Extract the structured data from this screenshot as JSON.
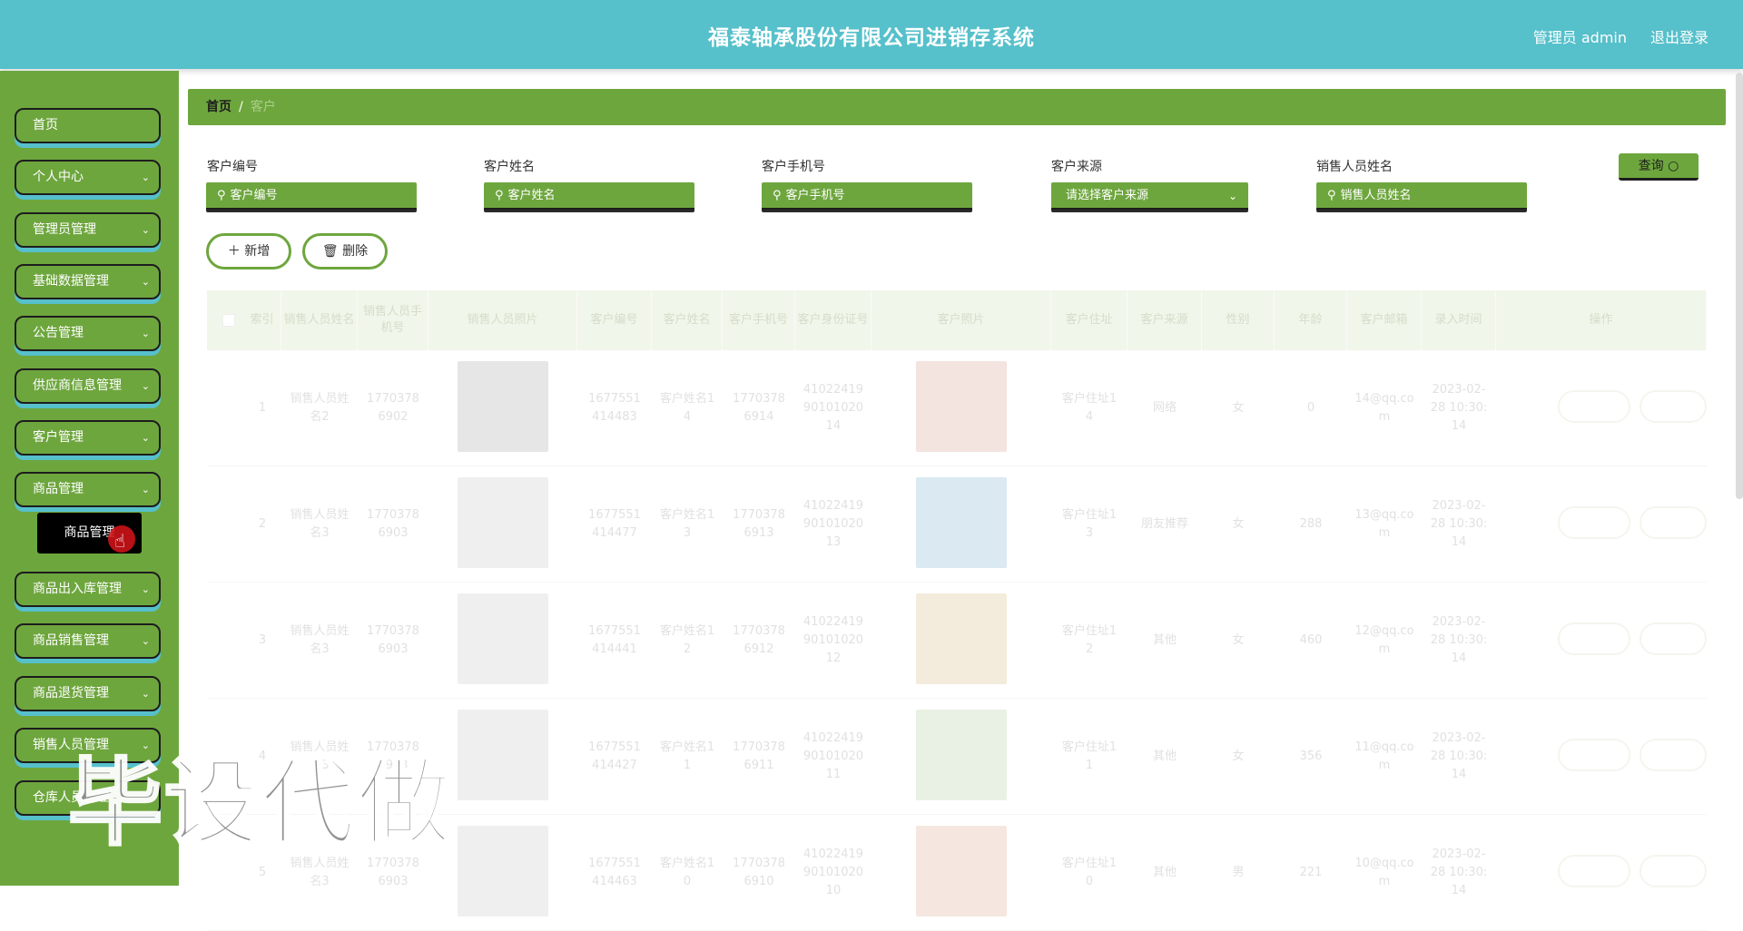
{
  "header": {
    "title": "福泰轴承股份有限公司进销存系统",
    "user": "管理员 admin",
    "logout": "退出登录"
  },
  "sidebar": {
    "items": [
      {
        "label": "首页",
        "has_children": false
      },
      {
        "label": "个人中心",
        "has_children": true
      },
      {
        "label": "管理员管理",
        "has_children": true
      },
      {
        "label": "基础数据管理",
        "has_children": true
      },
      {
        "label": "公告管理",
        "has_children": true
      },
      {
        "label": "供应商信息管理",
        "has_children": true
      },
      {
        "label": "客户管理",
        "has_children": true
      },
      {
        "label": "商品管理",
        "has_children": true
      },
      {
        "label": "商品出入库管理",
        "has_children": true
      },
      {
        "label": "商品销售管理",
        "has_children": true
      },
      {
        "label": "商品退货管理",
        "has_children": true
      },
      {
        "label": "销售人员管理",
        "has_children": true
      },
      {
        "label": "仓库人员管理",
        "has_children": true
      }
    ],
    "submenu_active": "商品管理",
    "chevron": "chevron-down-icon"
  },
  "breadcrumb": {
    "home": "首页",
    "separator": "/",
    "current": "客户"
  },
  "search": {
    "fields": [
      {
        "label": "客户编号",
        "placeholder": "客户编号"
      },
      {
        "label": "客户姓名",
        "placeholder": "客户姓名"
      },
      {
        "label": "客户手机号",
        "placeholder": "客户手机号"
      },
      {
        "label": "客户来源",
        "placeholder": "请选择客户来源"
      },
      {
        "label": "销售人员姓名",
        "placeholder": "销售人员姓名"
      }
    ],
    "query_label": "查询",
    "add_label": "新增",
    "delete_label": "删除"
  },
  "table": {
    "columns": [
      "索引",
      "销售人员姓名",
      "销售人员手机号",
      "销售人员照片",
      "客户编号",
      "客户姓名",
      "客户手机号",
      "客户身份证号",
      "客户照片",
      "客户住址",
      "客户来源",
      "性别",
      "年龄",
      "客户邮箱",
      "录入时间",
      "操作"
    ],
    "rows": [
      {
        "index": "1",
        "sales_name": "销售人员姓名2",
        "sales_phone": "17703786902",
        "code": "1677551414483",
        "name": "客户姓名14",
        "phone": "17703786914",
        "id_card": "410224199010102014",
        "address": "客户住址14",
        "source": "网络",
        "gender": "女",
        "age": "0",
        "email": "14@qq.com",
        "time": "2023-02-28 10:30:14"
      },
      {
        "index": "2",
        "sales_name": "销售人员姓名3",
        "sales_phone": "17703786903",
        "code": "1677551414477",
        "name": "客户姓名13",
        "phone": "17703786913",
        "id_card": "410224199010102013",
        "address": "客户住址13",
        "source": "朋友推荐",
        "gender": "女",
        "age": "288",
        "email": "13@qq.com",
        "time": "2023-02-28 10:30:14"
      },
      {
        "index": "3",
        "sales_name": "销售人员姓名3",
        "sales_phone": "17703786903",
        "code": "1677551414441",
        "name": "客户姓名12",
        "phone": "17703786912",
        "id_card": "410224199010102012",
        "address": "客户住址12",
        "source": "其他",
        "gender": "女",
        "age": "460",
        "email": "12@qq.com",
        "time": "2023-02-28 10:30:14"
      },
      {
        "index": "4",
        "sales_name": "销售人员姓名3",
        "sales_phone": "17703786903",
        "code": "1677551414427",
        "name": "客户姓名11",
        "phone": "17703786911",
        "id_card": "410224199010102011",
        "address": "客户住址11",
        "source": "其他",
        "gender": "女",
        "age": "356",
        "email": "11@qq.com",
        "time": "2023-02-28 10:30:14"
      },
      {
        "index": "5",
        "sales_name": "销售人员姓名3",
        "sales_phone": "17703786903",
        "code": "1677551414463",
        "name": "客户姓名10",
        "phone": "17703786910",
        "id_card": "410224199010102010",
        "address": "客户住址10",
        "source": "其他",
        "gender": "男",
        "age": "221",
        "email": "10@qq.com",
        "time": "2023-02-28 10:30:14"
      }
    ]
  },
  "watermark": "毕设代做",
  "colors": {
    "header": "#56c0cb",
    "green": "#6ea63e",
    "dark": "#1d1d1d",
    "active_submenu": "#000000"
  }
}
